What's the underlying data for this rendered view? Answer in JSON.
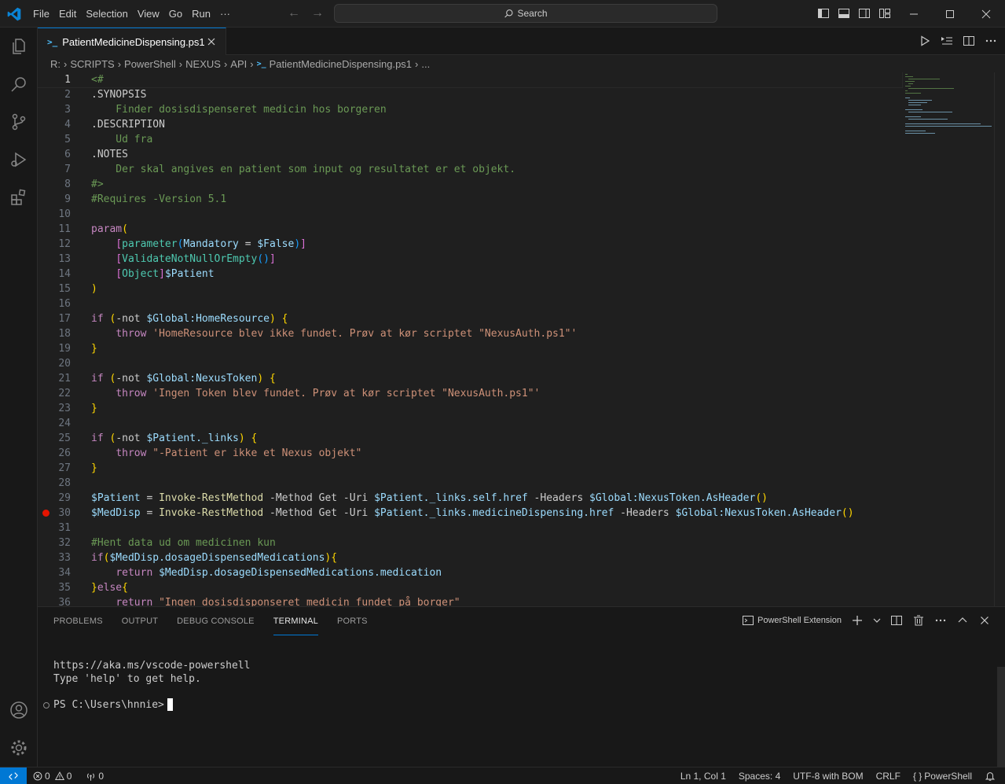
{
  "titlebar": {
    "menu": [
      "File",
      "Edit",
      "Selection",
      "View",
      "Go",
      "Run",
      "···"
    ],
    "search_placeholder": "Search"
  },
  "tab": {
    "label": "PatientMedicineDispensing.ps1",
    "glyph": ">_"
  },
  "breadcrumb": [
    "R:",
    "SCRIPTS",
    "PowerShell",
    "NEXUS",
    "API",
    "PatientMedicineDispensing.ps1",
    "..."
  ],
  "editor": {
    "current_line": 1,
    "breakpoint_line": 30,
    "lines": [
      [
        {
          "t": "<#",
          "c": "c-cmt"
        }
      ],
      [
        {
          "t": ".SYNOPSIS",
          "c": "c-doc"
        }
      ],
      [
        {
          "t": "    Finder dosisdispenseret medicin hos borgeren",
          "c": "c-cmt"
        }
      ],
      [
        {
          "t": ".DESCRIPTION",
          "c": "c-doc"
        }
      ],
      [
        {
          "t": "    Ud fra",
          "c": "c-cmt"
        }
      ],
      [
        {
          "t": ".NOTES",
          "c": "c-doc"
        }
      ],
      [
        {
          "t": "    Der skal angives en patient som input og resultatet er et objekt.",
          "c": "c-cmt"
        }
      ],
      [
        {
          "t": "#>",
          "c": "c-cmt"
        }
      ],
      [
        {
          "t": "#Requires -Version 5.1",
          "c": "c-cmt"
        }
      ],
      [],
      [
        {
          "t": "param",
          "c": "c-kw"
        },
        {
          "t": "(",
          "c": "c-br1"
        }
      ],
      [
        {
          "t": "    "
        },
        {
          "t": "[",
          "c": "c-br2"
        },
        {
          "t": "parameter",
          "c": "c-type"
        },
        {
          "t": "(",
          "c": "c-br3"
        },
        {
          "t": "Mandatory",
          "c": "c-var"
        },
        {
          "t": " = "
        },
        {
          "t": "$False",
          "c": "c-var"
        },
        {
          "t": ")",
          "c": "c-br3"
        },
        {
          "t": "]",
          "c": "c-br2"
        }
      ],
      [
        {
          "t": "    "
        },
        {
          "t": "[",
          "c": "c-br2"
        },
        {
          "t": "ValidateNotNullOrEmpty",
          "c": "c-type"
        },
        {
          "t": "()",
          "c": "c-br3"
        },
        {
          "t": "]",
          "c": "c-br2"
        }
      ],
      [
        {
          "t": "    "
        },
        {
          "t": "[",
          "c": "c-br2"
        },
        {
          "t": "Object",
          "c": "c-type"
        },
        {
          "t": "]",
          "c": "c-br2"
        },
        {
          "t": "$Patient",
          "c": "c-var"
        }
      ],
      [
        {
          "t": ")",
          "c": "c-br1"
        }
      ],
      [],
      [
        {
          "t": "if",
          "c": "c-kw"
        },
        {
          "t": " "
        },
        {
          "t": "(",
          "c": "c-br1"
        },
        {
          "t": "-not "
        },
        {
          "t": "$Global:HomeResource",
          "c": "c-var"
        },
        {
          "t": ")",
          "c": "c-br1"
        },
        {
          "t": " "
        },
        {
          "t": "{",
          "c": "c-br1"
        }
      ],
      [
        {
          "t": "    "
        },
        {
          "t": "throw",
          "c": "c-kw"
        },
        {
          "t": " "
        },
        {
          "t": "'HomeResource blev ikke fundet. Prøv at kør scriptet \"NexusAuth.ps1\"'",
          "c": "c-str"
        }
      ],
      [
        {
          "t": "}",
          "c": "c-br1"
        }
      ],
      [],
      [
        {
          "t": "if",
          "c": "c-kw"
        },
        {
          "t": " "
        },
        {
          "t": "(",
          "c": "c-br1"
        },
        {
          "t": "-not "
        },
        {
          "t": "$Global:NexusToken",
          "c": "c-var"
        },
        {
          "t": ")",
          "c": "c-br1"
        },
        {
          "t": " "
        },
        {
          "t": "{",
          "c": "c-br1"
        }
      ],
      [
        {
          "t": "    "
        },
        {
          "t": "throw",
          "c": "c-kw"
        },
        {
          "t": " "
        },
        {
          "t": "'Ingen Token blev fundet. Prøv at kør scriptet \"NexusAuth.ps1\"'",
          "c": "c-str"
        }
      ],
      [
        {
          "t": "}",
          "c": "c-br1"
        }
      ],
      [],
      [
        {
          "t": "if",
          "c": "c-kw"
        },
        {
          "t": " "
        },
        {
          "t": "(",
          "c": "c-br1"
        },
        {
          "t": "-not "
        },
        {
          "t": "$Patient._links",
          "c": "c-var"
        },
        {
          "t": ")",
          "c": "c-br1"
        },
        {
          "t": " "
        },
        {
          "t": "{",
          "c": "c-br1"
        }
      ],
      [
        {
          "t": "    "
        },
        {
          "t": "throw",
          "c": "c-kw"
        },
        {
          "t": " "
        },
        {
          "t": "\"-Patient er ikke et Nexus objekt\"",
          "c": "c-str"
        }
      ],
      [
        {
          "t": "}",
          "c": "c-br1"
        }
      ],
      [],
      [
        {
          "t": "$Patient",
          "c": "c-var"
        },
        {
          "t": " = "
        },
        {
          "t": "Invoke-RestMethod",
          "c": "c-fn"
        },
        {
          "t": " -Method Get -Uri "
        },
        {
          "t": "$Patient._links.self.href",
          "c": "c-var"
        },
        {
          "t": " -Headers "
        },
        {
          "t": "$Global:NexusToken.AsHeader",
          "c": "c-var"
        },
        {
          "t": "()",
          "c": "c-br1"
        }
      ],
      [
        {
          "t": "$MedDisp",
          "c": "c-var"
        },
        {
          "t": " = "
        },
        {
          "t": "Invoke-RestMethod",
          "c": "c-fn"
        },
        {
          "t": " -Method Get -Uri "
        },
        {
          "t": "$Patient._links.medicineDispensing.href",
          "c": "c-var"
        },
        {
          "t": " -Headers "
        },
        {
          "t": "$Global:NexusToken.AsHeader",
          "c": "c-var"
        },
        {
          "t": "()",
          "c": "c-br1"
        }
      ],
      [],
      [
        {
          "t": "#Hent data ud om medicinen kun",
          "c": "c-cmt"
        }
      ],
      [
        {
          "t": "if",
          "c": "c-kw"
        },
        {
          "t": "(",
          "c": "c-br1"
        },
        {
          "t": "$MedDisp.dosageDispensedMedications",
          "c": "c-var"
        },
        {
          "t": ")",
          "c": "c-br1"
        },
        {
          "t": "{",
          "c": "c-br1"
        }
      ],
      [
        {
          "t": "    "
        },
        {
          "t": "return",
          "c": "c-kw"
        },
        {
          "t": " "
        },
        {
          "t": "$MedDisp.dosageDispensedMedications.medication",
          "c": "c-var"
        }
      ],
      [
        {
          "t": "}",
          "c": "c-br1"
        },
        {
          "t": "else",
          "c": "c-kw"
        },
        {
          "t": "{",
          "c": "c-br1"
        }
      ],
      [
        {
          "t": "    "
        },
        {
          "t": "return",
          "c": "c-kw"
        },
        {
          "t": " "
        },
        {
          "t": "\"Ingen dosisdisponseret medicin fundet på borger\"",
          "c": "c-str"
        }
      ]
    ]
  },
  "panel": {
    "tabs": [
      "PROBLEMS",
      "OUTPUT",
      "DEBUG CONSOLE",
      "TERMINAL",
      "PORTS"
    ],
    "active_tab": "TERMINAL",
    "terminal_name": "PowerShell Extension",
    "terminal_lines": [
      "https://aka.ms/vscode-powershell",
      "Type 'help' to get help."
    ],
    "prompt": "PS C:\\Users\\hnnie>"
  },
  "statusbar": {
    "errors": "0",
    "warnings": "0",
    "ports": "0",
    "position": "Ln 1, Col 1",
    "spaces": "Spaces: 4",
    "encoding": "UTF-8 with BOM",
    "eol": "CRLF",
    "language": "PowerShell"
  },
  "colors": {
    "accent": "#0078d4",
    "breakpoint": "#e51400"
  }
}
